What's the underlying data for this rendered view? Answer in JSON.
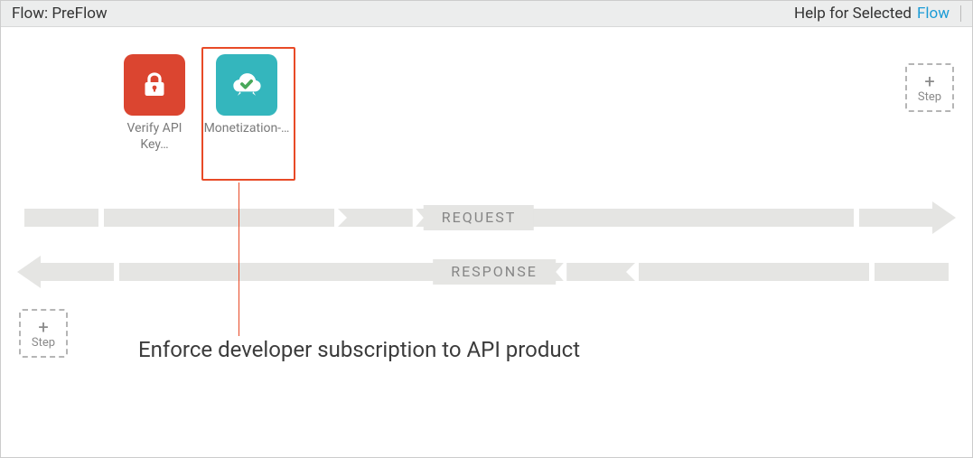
{
  "header": {
    "title": "Flow: PreFlow",
    "help_label": "Help for Selected",
    "help_link": "Flow"
  },
  "policies": [
    {
      "label": "Verify API Key…",
      "icon": "lock-icon",
      "color": "#db4530",
      "selected": false
    },
    {
      "label": "Monetization-…",
      "icon": "cloud-check-icon",
      "color": "#34b6bd",
      "selected": true
    }
  ],
  "flow": {
    "request_label": "REQUEST",
    "response_label": "RESPONSE"
  },
  "add_step_label": "Step",
  "annotation": "Enforce developer subscription to API product"
}
